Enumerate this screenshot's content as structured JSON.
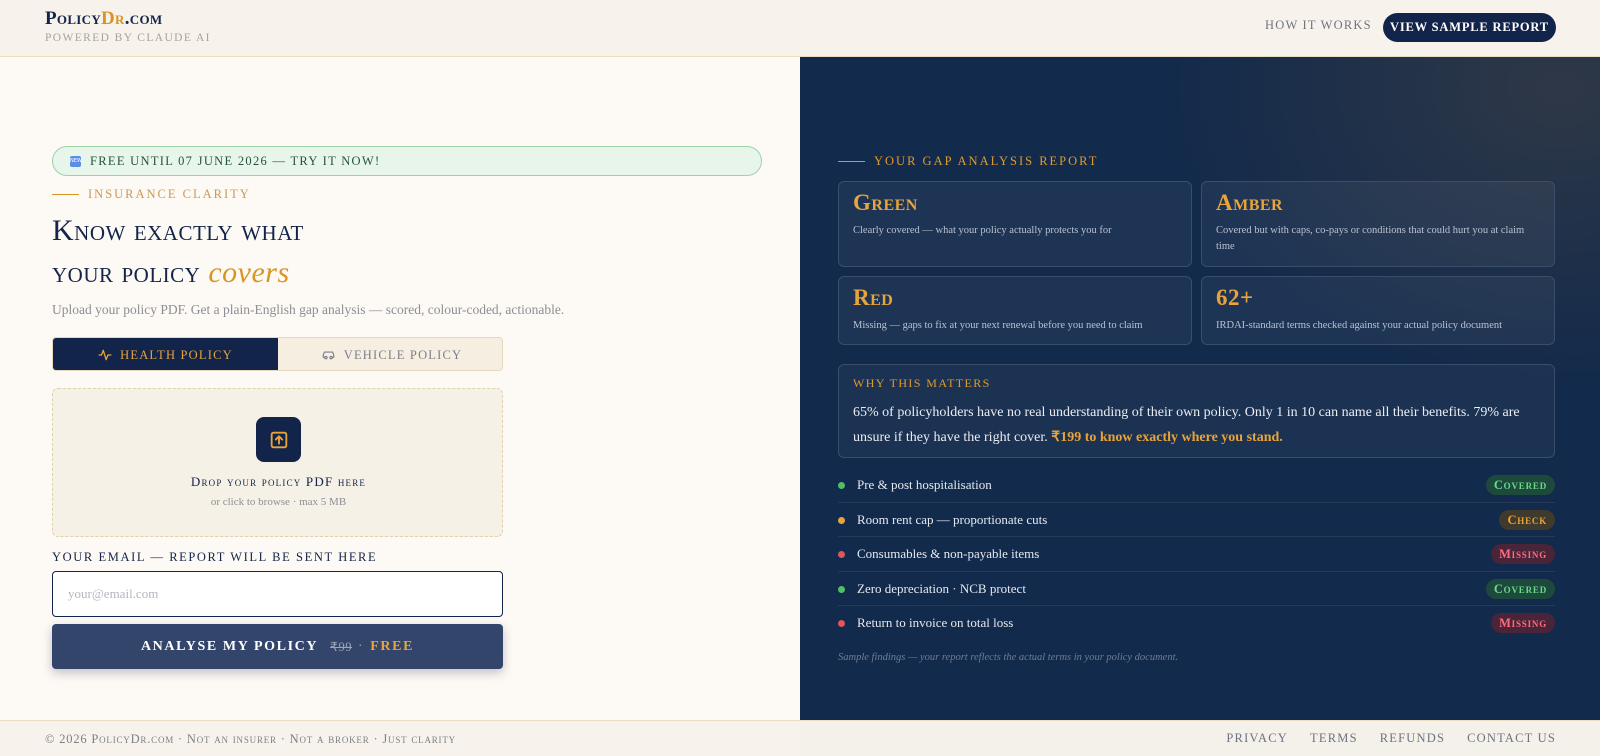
{
  "header": {
    "logo_prefix": "Policy",
    "logo_accent": "Dr",
    "logo_suffix": ".com",
    "powered_by": "Powered by Claude AI",
    "how_it_works": "How it works",
    "view_sample": "View Sample Report"
  },
  "left": {
    "promo_icon": "NEW",
    "promo_text": "Free until 07 June 2026 — try it now!",
    "eyebrow": "Insurance Clarity",
    "headline_line1": "Know exactly what",
    "headline_line2": "your policy",
    "headline_emphasis": "covers",
    "subtitle": "Upload your policy PDF. Get a plain-English gap analysis — scored, colour-coded, actionable.",
    "tabs": [
      {
        "label": "Health Policy",
        "icon": "heartbeat-icon",
        "active": true
      },
      {
        "label": "Vehicle Policy",
        "icon": "car-icon",
        "active": false
      }
    ],
    "drop_title": "Drop your policy PDF here",
    "drop_sub": "or click to browse · max 5 MB",
    "email_label": "Your email — report will be sent here",
    "email_placeholder": "your@email.com",
    "email_value": "",
    "analyse_label": "Analyse My Policy",
    "analyse_old_price": "₹99",
    "analyse_sep": "·",
    "analyse_free": "Free"
  },
  "right": {
    "eyebrow": "Your Gap Analysis Report",
    "cards": [
      {
        "title": "Green",
        "desc": "Clearly covered — what your policy actually protects you for"
      },
      {
        "title": "Amber",
        "desc": "Covered but with caps, co-pays or conditions that could hurt you at claim time"
      },
      {
        "title": "Red",
        "desc": "Missing — gaps to fix at your next renewal before you need to claim"
      },
      {
        "title": "62+",
        "desc": "IRDAI-standard terms checked against your actual policy document"
      }
    ],
    "why_title": "Why this matters",
    "why_body": "65% of policyholders have no real understanding of their own policy. Only 1 in 10 can name all their benefits. 79% are unsure if they have the right cover.",
    "why_highlight": "₹199 to know exactly where you stand.",
    "findings": [
      {
        "label": "Pre & post hospitalisation",
        "status": "Covered",
        "color": "#4fbf6a"
      },
      {
        "label": "Room rent cap — proportionate cuts",
        "status": "Check",
        "color": "#e8a43a"
      },
      {
        "label": "Consumables & non-payable items",
        "status": "Missing",
        "color": "#e0555f"
      },
      {
        "label": "Zero depreciation · NCB protect",
        "status": "Covered",
        "color": "#4fbf6a"
      },
      {
        "label": "Return to invoice on total loss",
        "status": "Missing",
        "color": "#e0555f"
      }
    ],
    "sample_note": "Sample findings — your report reflects the actual terms in your policy document."
  },
  "footer": {
    "copyright": "© 2026 PolicyDr.com · Not an insurer · Not a broker · Just clarity",
    "links": [
      "Privacy",
      "Terms",
      "Refunds",
      "Contact Us"
    ]
  }
}
